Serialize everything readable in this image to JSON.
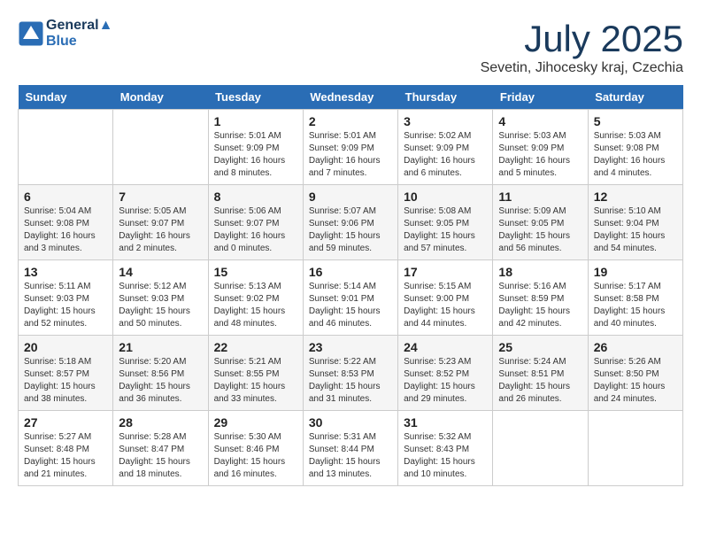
{
  "header": {
    "logo_line1": "General",
    "logo_line2": "Blue",
    "month": "July 2025",
    "location": "Sevetin, Jihocesky kraj, Czechia"
  },
  "weekdays": [
    "Sunday",
    "Monday",
    "Tuesday",
    "Wednesday",
    "Thursday",
    "Friday",
    "Saturday"
  ],
  "weeks": [
    [
      {
        "day": "",
        "info": ""
      },
      {
        "day": "",
        "info": ""
      },
      {
        "day": "1",
        "info": "Sunrise: 5:01 AM\nSunset: 9:09 PM\nDaylight: 16 hours and 8 minutes."
      },
      {
        "day": "2",
        "info": "Sunrise: 5:01 AM\nSunset: 9:09 PM\nDaylight: 16 hours and 7 minutes."
      },
      {
        "day": "3",
        "info": "Sunrise: 5:02 AM\nSunset: 9:09 PM\nDaylight: 16 hours and 6 minutes."
      },
      {
        "day": "4",
        "info": "Sunrise: 5:03 AM\nSunset: 9:09 PM\nDaylight: 16 hours and 5 minutes."
      },
      {
        "day": "5",
        "info": "Sunrise: 5:03 AM\nSunset: 9:08 PM\nDaylight: 16 hours and 4 minutes."
      }
    ],
    [
      {
        "day": "6",
        "info": "Sunrise: 5:04 AM\nSunset: 9:08 PM\nDaylight: 16 hours and 3 minutes."
      },
      {
        "day": "7",
        "info": "Sunrise: 5:05 AM\nSunset: 9:07 PM\nDaylight: 16 hours and 2 minutes."
      },
      {
        "day": "8",
        "info": "Sunrise: 5:06 AM\nSunset: 9:07 PM\nDaylight: 16 hours and 0 minutes."
      },
      {
        "day": "9",
        "info": "Sunrise: 5:07 AM\nSunset: 9:06 PM\nDaylight: 15 hours and 59 minutes."
      },
      {
        "day": "10",
        "info": "Sunrise: 5:08 AM\nSunset: 9:05 PM\nDaylight: 15 hours and 57 minutes."
      },
      {
        "day": "11",
        "info": "Sunrise: 5:09 AM\nSunset: 9:05 PM\nDaylight: 15 hours and 56 minutes."
      },
      {
        "day": "12",
        "info": "Sunrise: 5:10 AM\nSunset: 9:04 PM\nDaylight: 15 hours and 54 minutes."
      }
    ],
    [
      {
        "day": "13",
        "info": "Sunrise: 5:11 AM\nSunset: 9:03 PM\nDaylight: 15 hours and 52 minutes."
      },
      {
        "day": "14",
        "info": "Sunrise: 5:12 AM\nSunset: 9:03 PM\nDaylight: 15 hours and 50 minutes."
      },
      {
        "day": "15",
        "info": "Sunrise: 5:13 AM\nSunset: 9:02 PM\nDaylight: 15 hours and 48 minutes."
      },
      {
        "day": "16",
        "info": "Sunrise: 5:14 AM\nSunset: 9:01 PM\nDaylight: 15 hours and 46 minutes."
      },
      {
        "day": "17",
        "info": "Sunrise: 5:15 AM\nSunset: 9:00 PM\nDaylight: 15 hours and 44 minutes."
      },
      {
        "day": "18",
        "info": "Sunrise: 5:16 AM\nSunset: 8:59 PM\nDaylight: 15 hours and 42 minutes."
      },
      {
        "day": "19",
        "info": "Sunrise: 5:17 AM\nSunset: 8:58 PM\nDaylight: 15 hours and 40 minutes."
      }
    ],
    [
      {
        "day": "20",
        "info": "Sunrise: 5:18 AM\nSunset: 8:57 PM\nDaylight: 15 hours and 38 minutes."
      },
      {
        "day": "21",
        "info": "Sunrise: 5:20 AM\nSunset: 8:56 PM\nDaylight: 15 hours and 36 minutes."
      },
      {
        "day": "22",
        "info": "Sunrise: 5:21 AM\nSunset: 8:55 PM\nDaylight: 15 hours and 33 minutes."
      },
      {
        "day": "23",
        "info": "Sunrise: 5:22 AM\nSunset: 8:53 PM\nDaylight: 15 hours and 31 minutes."
      },
      {
        "day": "24",
        "info": "Sunrise: 5:23 AM\nSunset: 8:52 PM\nDaylight: 15 hours and 29 minutes."
      },
      {
        "day": "25",
        "info": "Sunrise: 5:24 AM\nSunset: 8:51 PM\nDaylight: 15 hours and 26 minutes."
      },
      {
        "day": "26",
        "info": "Sunrise: 5:26 AM\nSunset: 8:50 PM\nDaylight: 15 hours and 24 minutes."
      }
    ],
    [
      {
        "day": "27",
        "info": "Sunrise: 5:27 AM\nSunset: 8:48 PM\nDaylight: 15 hours and 21 minutes."
      },
      {
        "day": "28",
        "info": "Sunrise: 5:28 AM\nSunset: 8:47 PM\nDaylight: 15 hours and 18 minutes."
      },
      {
        "day": "29",
        "info": "Sunrise: 5:30 AM\nSunset: 8:46 PM\nDaylight: 15 hours and 16 minutes."
      },
      {
        "day": "30",
        "info": "Sunrise: 5:31 AM\nSunset: 8:44 PM\nDaylight: 15 hours and 13 minutes."
      },
      {
        "day": "31",
        "info": "Sunrise: 5:32 AM\nSunset: 8:43 PM\nDaylight: 15 hours and 10 minutes."
      },
      {
        "day": "",
        "info": ""
      },
      {
        "day": "",
        "info": ""
      }
    ]
  ]
}
